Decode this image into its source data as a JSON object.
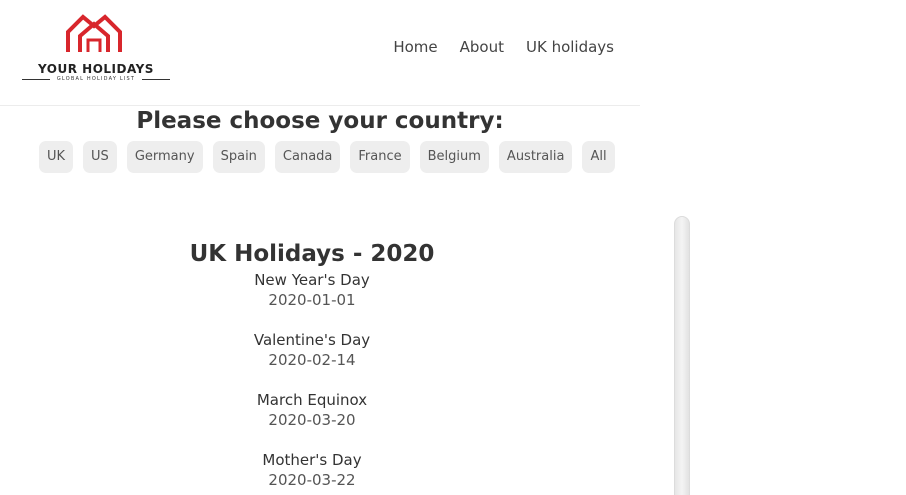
{
  "logo": {
    "title": "YOUR HOLIDAYS",
    "subtitle": "GLOBAL HOLIDAY LIST",
    "colors": {
      "house": "#d8262c"
    }
  },
  "nav": {
    "items": [
      "Home",
      "About",
      "UK holidays"
    ]
  },
  "country_select": {
    "heading": "Please choose your country:",
    "options": [
      "UK",
      "US",
      "Germany",
      "Spain",
      "Canada",
      "France",
      "Belgium",
      "Australia",
      "All"
    ]
  },
  "holidays": {
    "title": "UK Holidays - 2020",
    "items": [
      {
        "name": "New Year's Day",
        "date": "2020-01-01"
      },
      {
        "name": "Valentine's Day",
        "date": "2020-02-14"
      },
      {
        "name": "March Equinox",
        "date": "2020-03-20"
      },
      {
        "name": "Mother's Day",
        "date": "2020-03-22"
      }
    ]
  }
}
